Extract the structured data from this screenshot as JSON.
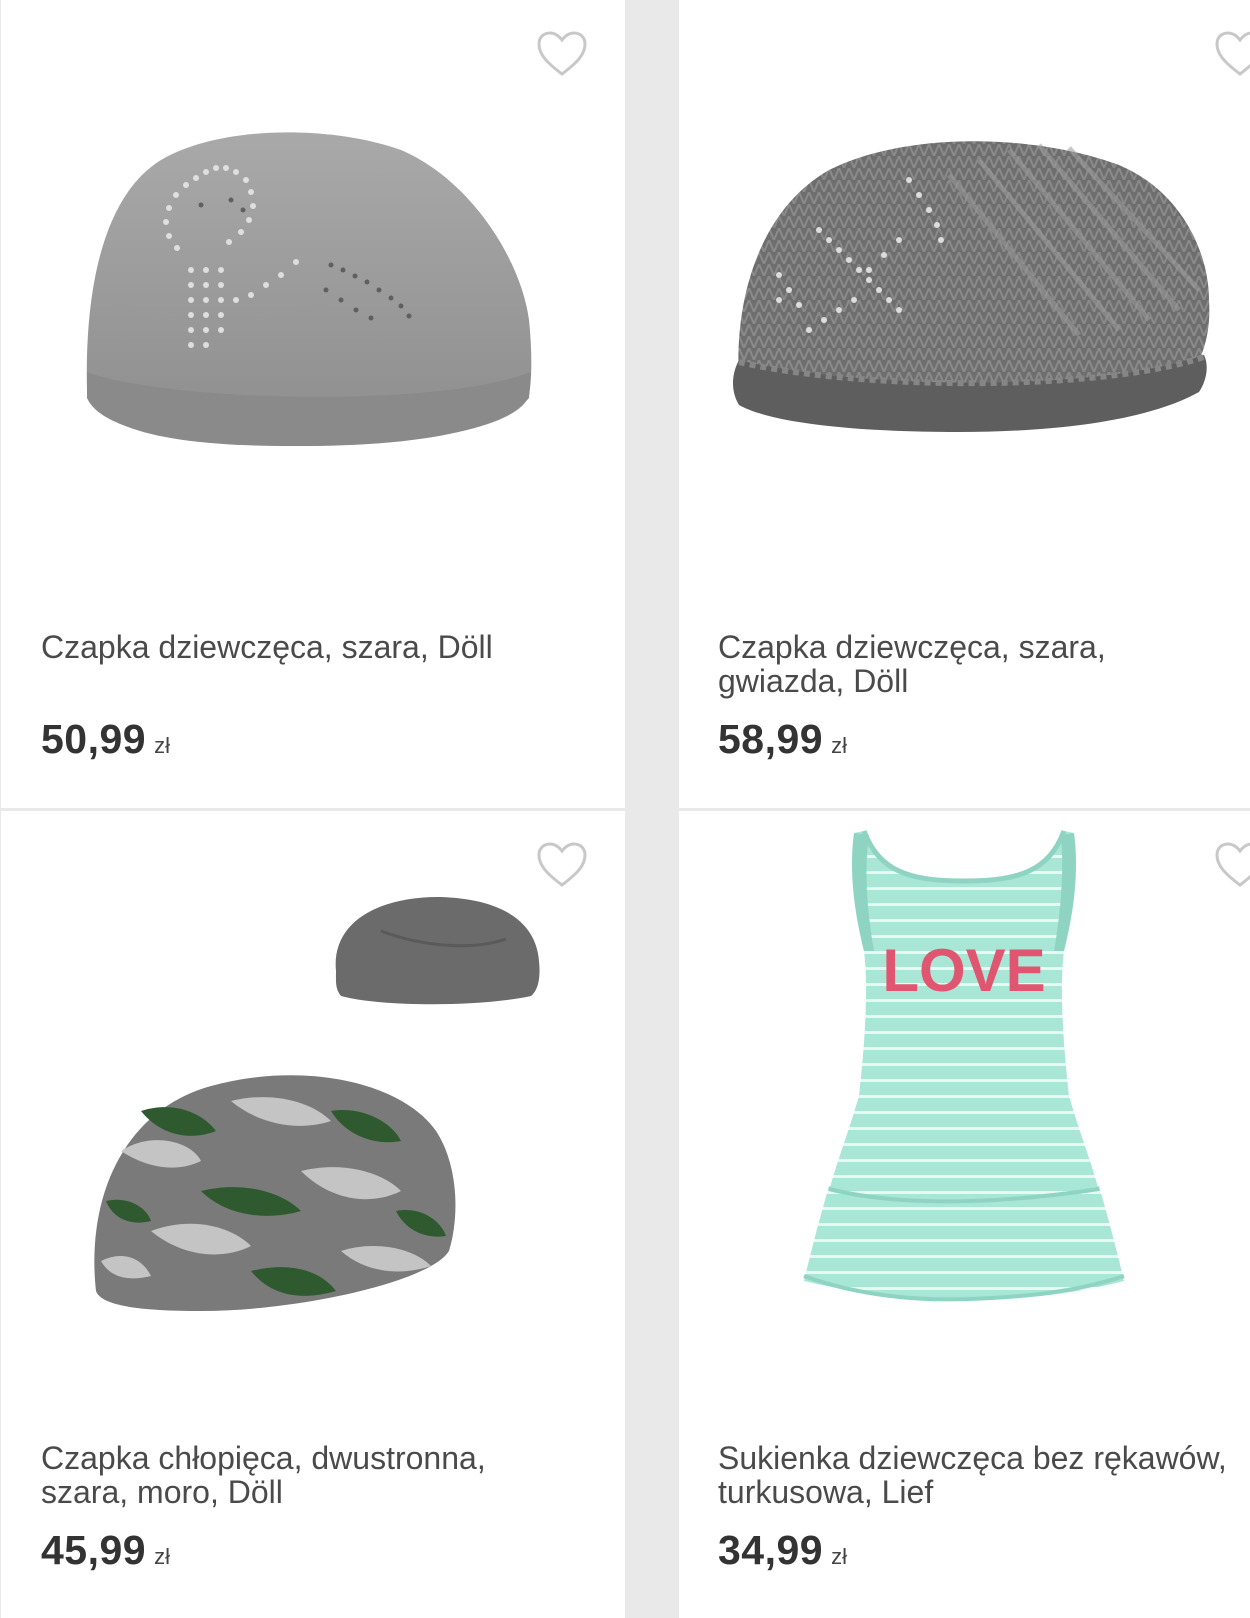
{
  "products": [
    {
      "title": "Czapka dziewczęca, szara, Döll",
      "price": "50,99",
      "currency": "zł",
      "image": "grey-knit-beanie-with-rhinestones",
      "favorite_icon": "heart-outline-icon"
    },
    {
      "title": "Czapka dziewczęca, szara, gwiazda, Döll",
      "price": "58,99",
      "currency": "zł",
      "image": "dark-grey-knit-beanie-with-star",
      "favorite_icon": "heart-outline-icon"
    },
    {
      "title": "Czapka chłopięca, dwustronna, szara, moro, Döll",
      "price": "45,99",
      "currency": "zł",
      "image": "reversible-camo-beanie",
      "favorite_icon": "heart-outline-icon"
    },
    {
      "title_line1": "Sukienka dziewczęca bez rękawów,",
      "title_line2": "turkusowa, Lief",
      "price": "34,99",
      "currency": "zł",
      "image": "mint-striped-sleeveless-dress",
      "print_text": "LOVE",
      "favorite_icon": "heart-outline-icon"
    }
  ],
  "colors": {
    "page_bg": "#e9e9e9",
    "card_bg": "#ffffff",
    "title": "#4a4a4a",
    "price": "#333333",
    "heart": "#c8c8c8"
  }
}
